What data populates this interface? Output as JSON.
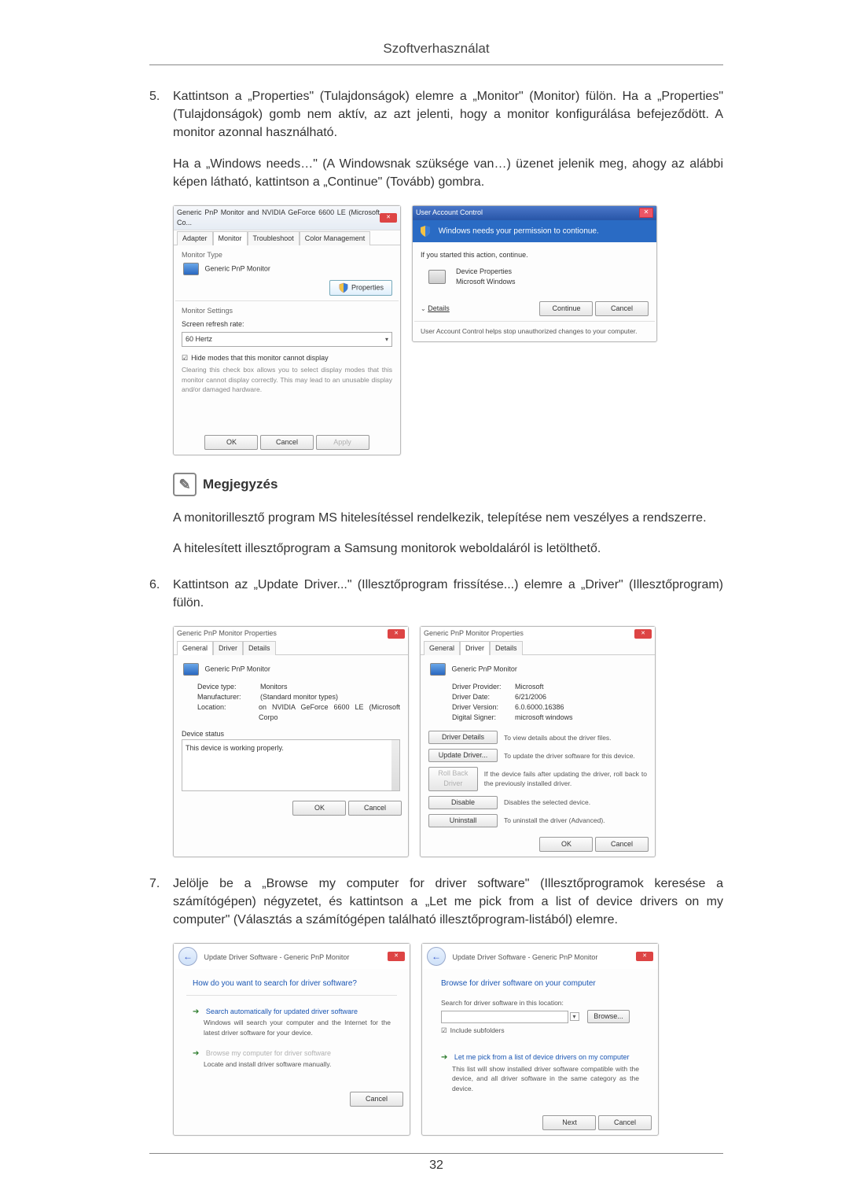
{
  "header": {
    "title": "Szoftverhasználat"
  },
  "steps": {
    "s5_num": "5.",
    "s5_p1": "Kattintson a „Properties\" (Tulajdonságok) elemre a „Monitor\" (Monitor) fülön. Ha a „Properties\" (Tulajdonságok) gomb nem aktív, az azt jelenti, hogy a monitor konfigurálása befejeződött. A monitor azonnal használható.",
    "s5_p2": "Ha a „Windows needs…\" (A Windowsnak szüksége van…) üzenet jelenik meg, ahogy az alábbi képen látható, kattintson a „Continue\" (Tovább) gombra.",
    "s6_num": "6.",
    "s6_p1": "Kattintson az „Update Driver...\" (Illesztőprogram frissítése...) elemre a „Driver\" (Illesztőprogram) fülön.",
    "s7_num": "7.",
    "s7_p1": "Jelölje be a „Browse my computer for driver software\" (Illesztőprogramok keresése a számítógépen) négyzetet, és kattintson a „Let me pick from a list of device drivers on my computer\" (Választás a számítógépen található illesztőprogram-listából) elemre."
  },
  "note": {
    "label": "Megjegyzés",
    "p1": "A monitorillesztő program MS hitelesítéssel rendelkezik, telepítése nem veszélyes a rendszerre.",
    "p2": "A hitelesített illesztőprogram a Samsung monitorok weboldaláról is letölthető."
  },
  "fig1": {
    "title": "Generic PnP Monitor and NVIDIA GeForce 6600 LE (Microsoft Co...",
    "tabs": [
      "Adapter",
      "Monitor",
      "Troubleshoot",
      "Color Management"
    ],
    "monitor_type_label": "Monitor Type",
    "monitor_name": "Generic PnP Monitor",
    "properties_btn": "Properties",
    "settings_label": "Monitor Settings",
    "refresh_label": "Screen refresh rate:",
    "refresh_value": "60 Hertz",
    "hide_modes": "Hide modes that this monitor cannot display",
    "hide_desc": "Clearing this check box allows you to select display modes that this monitor cannot display correctly. This may lead to an unusable display and/or damaged hardware.",
    "ok": "OK",
    "cancel": "Cancel",
    "apply": "Apply"
  },
  "fig2": {
    "title": "User Account Control",
    "bar": "Windows needs your permission to contionue.",
    "ifstarted": "If you started this action, continue.",
    "devprop": "Device Properties",
    "msw": "Microsoft Windows",
    "details": "Details",
    "continue": "Continue",
    "cancel": "Cancel",
    "footer": "User Account Control helps stop unauthorized changes to your computer."
  },
  "fig3": {
    "title": "Generic PnP Monitor Properties",
    "tabs": [
      "General",
      "Driver",
      "Details"
    ],
    "name": "Generic PnP Monitor",
    "rows": {
      "device_type_k": "Device type:",
      "device_type_v": "Monitors",
      "manufacturer_k": "Manufacturer:",
      "manufacturer_v": "(Standard monitor types)",
      "location_k": "Location:",
      "location_v": "on NVIDIA GeForce 6600 LE (Microsoft Corpo"
    },
    "status_label": "Device status",
    "status_text": "This device is working properly.",
    "ok": "OK",
    "cancel": "Cancel"
  },
  "fig4": {
    "title": "Generic PnP Monitor Properties",
    "tabs": [
      "General",
      "Driver",
      "Details"
    ],
    "name": "Generic PnP Monitor",
    "rows": {
      "prov_k": "Driver Provider:",
      "prov_v": "Microsoft",
      "date_k": "Driver Date:",
      "date_v": "6/21/2006",
      "ver_k": "Driver Version:",
      "ver_v": "6.0.6000.16386",
      "signer_k": "Digital Signer:",
      "signer_v": "microsoft windows"
    },
    "btns": {
      "details": "Driver Details",
      "details_d": "To view details about the driver files.",
      "update": "Update Driver...",
      "update_d": "To update the driver software for this device.",
      "rollback": "Roll Back Driver",
      "rollback_d": "If the device fails after updating the driver, roll back to the previously installed driver.",
      "disable": "Disable",
      "disable_d": "Disables the selected device.",
      "uninstall": "Uninstall",
      "uninstall_d": "To uninstall the driver (Advanced)."
    },
    "ok": "OK",
    "cancel": "Cancel"
  },
  "fig5": {
    "crumb": "Update Driver Software - Generic PnP Monitor",
    "q": "How do you want to search for driver software?",
    "opt1_t": "Search automatically for updated driver software",
    "opt1_d": "Windows will search your computer and the Internet for the latest driver software for your device.",
    "opt2_t": "Browse my computer for driver software",
    "opt2_d": "Locate and install driver software manually.",
    "cancel": "Cancel"
  },
  "fig6": {
    "crumb": "Update Driver Software - Generic PnP Monitor",
    "h": "Browse for driver software on your computer",
    "search_label": "Search for driver software in this location:",
    "browse": "Browse...",
    "include": "Include subfolders",
    "opt_t": "Let me pick from a list of device drivers on my computer",
    "opt_d": "This list will show installed driver software compatible with the device, and all driver software in the same category as the device.",
    "next": "Next",
    "cancel": "Cancel"
  },
  "pagenum": "32"
}
